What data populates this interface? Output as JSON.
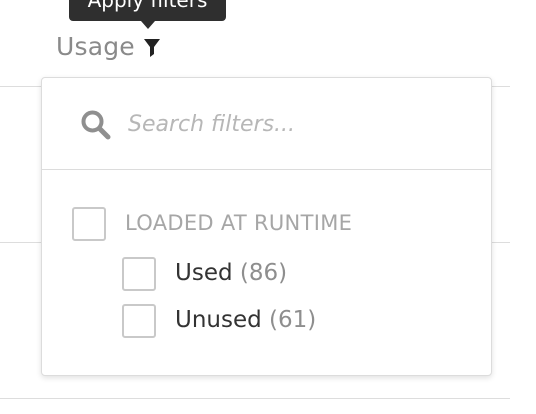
{
  "tooltip": {
    "text": "Apply filters"
  },
  "column": {
    "label": "Usage",
    "icon": "filter-icon"
  },
  "filter_panel": {
    "search": {
      "placeholder": "Search filters...",
      "value": "",
      "icon": "search-icon"
    },
    "group": {
      "label": "LOADED AT RUNTIME",
      "checked": false,
      "options": [
        {
          "label": "Used",
          "count": "(86)",
          "checked": false
        },
        {
          "label": "Unused",
          "count": "(61)",
          "checked": false
        }
      ]
    }
  },
  "colors": {
    "tooltip_bg": "#2f2f2f",
    "header_text": "#8a8a8a",
    "border": "#dcdcdc",
    "checkbox_border": "#c9c9c9"
  }
}
